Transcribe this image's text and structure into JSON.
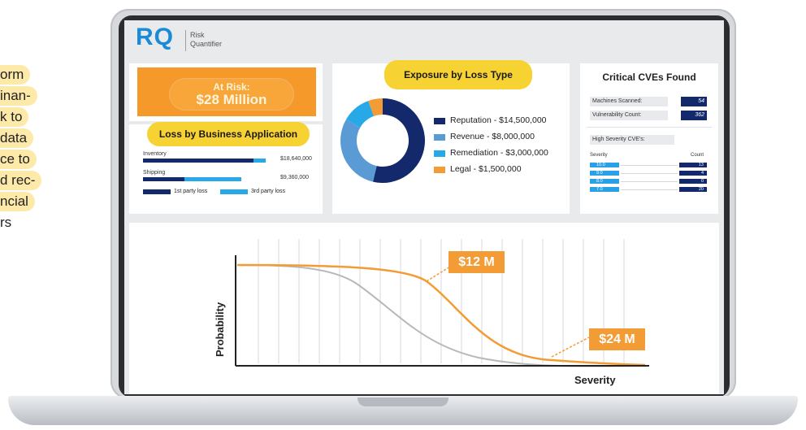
{
  "side_text": {
    "lines": [
      "orm",
      "inan-",
      "k to",
      "data",
      "ce to",
      "d rec-",
      "ncial",
      "rs"
    ]
  },
  "header": {
    "logo": "RQ",
    "subtitle_line1": "Risk",
    "subtitle_line2": "Quantifier"
  },
  "at_risk": {
    "label": "At Risk:",
    "value": "$28 Million"
  },
  "loss_by_app": {
    "title": "Loss by Business Application",
    "rows": [
      {
        "label": "Inventory",
        "value": "$18,640,000",
        "first_party": 0.8,
        "third_party": 0.09
      },
      {
        "label": "Shipping",
        "value": "$9,360,000",
        "first_party": 0.3,
        "third_party": 0.41
      }
    ],
    "legend": [
      {
        "label": "1st party loss",
        "color": "#13296b"
      },
      {
        "label": "3rd party loss",
        "color": "#27a9e8"
      }
    ]
  },
  "exposure": {
    "title": "Exposure by Loss Type",
    "chart_data": {
      "type": "pie",
      "donut": true,
      "labels": [
        "Reputation - $14,500,000",
        "Revenue - $8,000,000",
        "Remediation - $3,000,000",
        "Legal - $1,500,000"
      ],
      "values": [
        14500000,
        8000000,
        3000000,
        1500000
      ],
      "colors": [
        "#13296b",
        "#5b9bd5",
        "#27a9e8",
        "#f39b34"
      ]
    }
  },
  "cves": {
    "title": "Critical CVEs Found",
    "machines_label": "Machines Scanned:",
    "machines_value": "54",
    "vuln_label": "Vulnerability Count:",
    "vuln_value": "362",
    "high_sev_label": "High Severity CVE's:",
    "col_severity": "Severity",
    "col_count": "Count",
    "rows": [
      {
        "severity": "10.0",
        "count": "13"
      },
      {
        "severity": "9.0",
        "count": "4"
      },
      {
        "severity": "8.0",
        "count": "0"
      },
      {
        "severity": "7.0",
        "count": "20"
      }
    ]
  },
  "curve": {
    "ylabel": "Probability",
    "xlabel": "Severity",
    "callout1": "$12 M",
    "callout2": "$24 M",
    "chart_data": {
      "type": "line",
      "xlabel": "Severity",
      "ylabel": "Probability",
      "series": [
        {
          "color": "#f39b34",
          "description": "exceedance curve (orange)"
        },
        {
          "color": "#b8b8b8",
          "description": "exceedance curve (gray)"
        }
      ],
      "annotations": [
        "$12 M",
        "$24 M"
      ]
    }
  }
}
